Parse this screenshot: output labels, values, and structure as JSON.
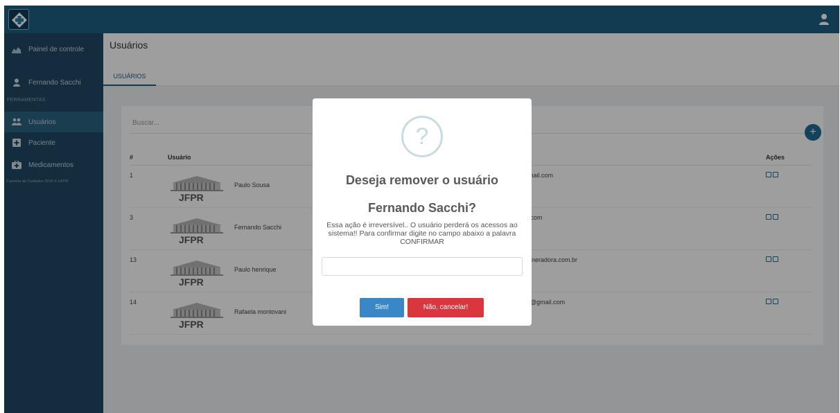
{
  "sidebar": {
    "items": [
      {
        "label": "Painel de controle",
        "icon": "chart-icon"
      },
      {
        "label": "Fernando Sacchi",
        "icon": "user-icon"
      }
    ],
    "section_label": "FERRAMENTAS",
    "tools": [
      {
        "label": "Usuários",
        "icon": "users-icon",
        "active": true
      },
      {
        "label": "Paciente",
        "icon": "plus-square-icon"
      },
      {
        "label": "Medicamentos",
        "icon": "medkit-icon"
      }
    ],
    "footer": "Caixinha de Cuidados 2016 © UFPR"
  },
  "page": {
    "title": "Usuários",
    "tab": "USUÁRIOS"
  },
  "search": {
    "placeholder": "Buscar..."
  },
  "table": {
    "headers": [
      "#",
      "Usuário",
      "Ações"
    ],
    "rows": [
      {
        "id": "1",
        "name": "Paulo Sousa",
        "email": "gmail.com"
      },
      {
        "id": "3",
        "name": "Fernando Sacchi",
        "email": ".com"
      },
      {
        "id": "13",
        "name": "Paulo henrique",
        "email": "neradora.com.br"
      },
      {
        "id": "14",
        "name": "Rafaela montovani",
        "email": "a@gmail.com"
      }
    ],
    "logo_text": "JFPR"
  },
  "modal": {
    "icon": "question-icon",
    "icon_glyph": "?",
    "title_line1": "Deseja remover o usuário",
    "title_line2": "Fernando Sacchi?",
    "message": "Essa ação é irreversível.. O usuário perderá os acessos ao sistema!! Para confirmar digite no campo abaixo a palavra CONFIRMAR",
    "input_value": "",
    "confirm_label": "Sim!",
    "cancel_label": "Não, cancelar!"
  },
  "colors": {
    "topbar": "#1b5f84",
    "sidebar": "#1f4a66",
    "confirm": "#3a87c8",
    "cancel": "#d9363e"
  },
  "add_button_glyph": "+"
}
